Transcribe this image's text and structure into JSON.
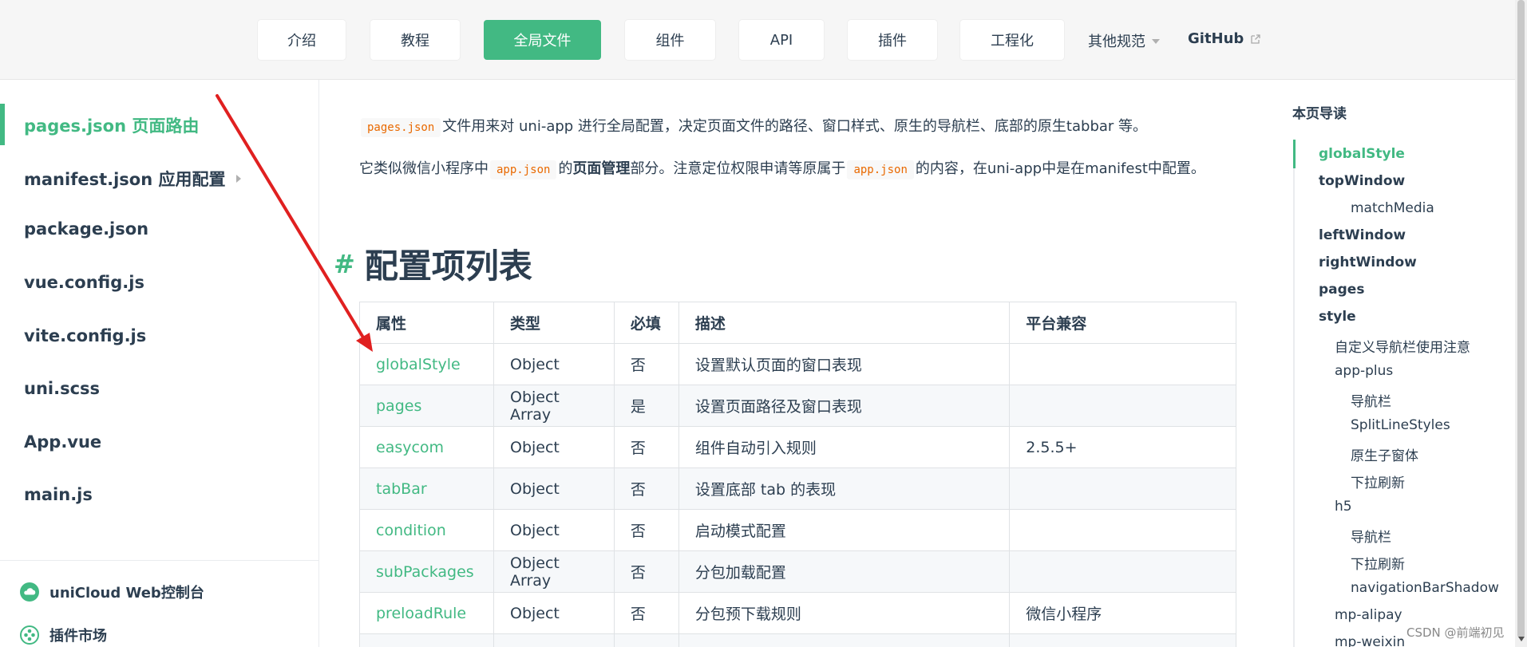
{
  "nav": {
    "items": [
      {
        "label": "介绍"
      },
      {
        "label": "教程"
      },
      {
        "label": "全局文件"
      },
      {
        "label": "组件"
      },
      {
        "label": "API"
      },
      {
        "label": "插件"
      },
      {
        "label": "工程化"
      }
    ],
    "more_label": "其他规范",
    "github_label": "GitHub",
    "accent_color": "#42b983"
  },
  "sidebar": {
    "items": [
      {
        "label": "pages.json 页面路由"
      },
      {
        "label": "manifest.json 应用配置"
      },
      {
        "label": "package.json"
      },
      {
        "label": "vue.config.js"
      },
      {
        "label": "vite.config.js"
      },
      {
        "label": "uni.scss"
      },
      {
        "label": "App.vue"
      },
      {
        "label": "main.js"
      }
    ],
    "links": [
      {
        "label": "uniCloud Web控制台",
        "icon": "cloud-icon"
      },
      {
        "label": "插件市场",
        "icon": "plugin-market-icon"
      }
    ]
  },
  "content": {
    "p1": {
      "code": "pages.json",
      "text": "文件用来对 uni-app 进行全局配置，决定页面文件的路径、窗口样式、原生的导航栏、底部的原生tabbar 等。"
    },
    "p2": {
      "prefix": "它类似微信小程序中",
      "code1": "app.json",
      "de": "的",
      "bold": "页面管理",
      "middle": "部分。注意定位权限申请等原属于",
      "code2": "app.json",
      "suffix": "的内容，在uni-app中是在manifest中配置。"
    },
    "heading": {
      "hash": "#",
      "title": "配置项列表"
    },
    "table": {
      "headers": [
        "属性",
        "类型",
        "必填",
        "描述",
        "平台兼容"
      ],
      "rows": [
        [
          "globalStyle",
          "Object",
          "否",
          "设置默认页面的窗口表现",
          ""
        ],
        [
          "pages",
          "Object Array",
          "是",
          "设置页面路径及窗口表现",
          ""
        ],
        [
          "easycom",
          "Object",
          "否",
          "组件自动引入规则",
          "2.5.5+"
        ],
        [
          "tabBar",
          "Object",
          "否",
          "设置底部 tab 的表现",
          ""
        ],
        [
          "condition",
          "Object",
          "否",
          "启动模式配置",
          ""
        ],
        [
          "subPackages",
          "Object Array",
          "否",
          "分包加载配置",
          ""
        ],
        [
          "preloadRule",
          "Object",
          "否",
          "分包预下载规则",
          "微信小程序"
        ]
      ]
    }
  },
  "toc": {
    "title": "本页导读",
    "items": [
      {
        "label": "globalStyle"
      },
      {
        "label": "topWindow"
      },
      {
        "label": "matchMedia"
      },
      {
        "label": "leftWindow"
      },
      {
        "label": "rightWindow"
      },
      {
        "label": "pages"
      },
      {
        "label": "style"
      },
      {
        "label": "自定义导航栏使用注意"
      },
      {
        "label": "app-plus"
      },
      {
        "label": "导航栏"
      },
      {
        "label": "SplitLineStyles"
      },
      {
        "label": "原生子窗体"
      },
      {
        "label": "下拉刷新"
      },
      {
        "label": "h5"
      },
      {
        "label": "导航栏"
      },
      {
        "label": "下拉刷新"
      },
      {
        "label": "navigationBarShadow"
      },
      {
        "label": "mp-alipay"
      },
      {
        "label": "mp-weixin"
      }
    ]
  },
  "watermark": "CSDN @前端初见",
  "annotation_color": "#e02020"
}
